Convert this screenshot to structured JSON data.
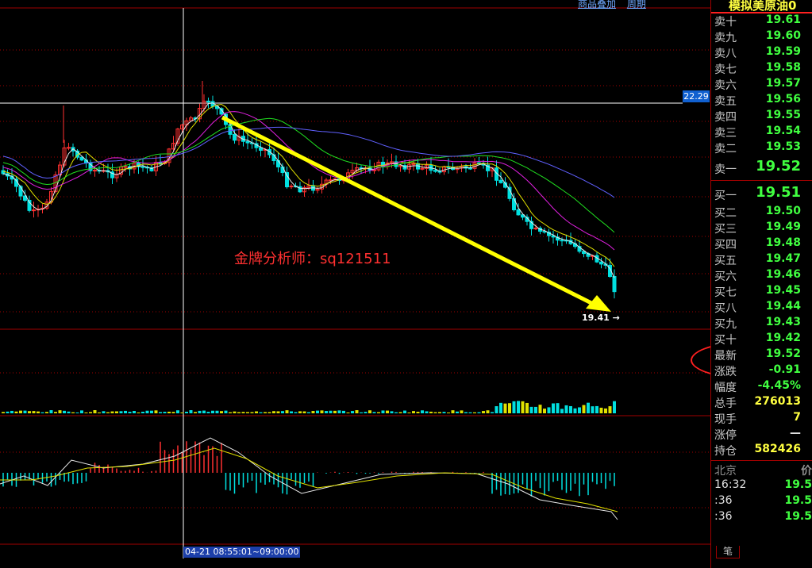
{
  "top_links": [
    "商品叠加",
    "周期"
  ],
  "price_tag": "22.29",
  "last_price_label": "19.41",
  "watermark": "金牌分析师：sq121511",
  "time_label": "04-21 08:55:01~09:00:00",
  "panel": {
    "title": "模拟美原油0",
    "asks": [
      {
        "label": "卖十",
        "value": "19.61"
      },
      {
        "label": "卖九",
        "value": "19.60"
      },
      {
        "label": "卖八",
        "value": "19.59"
      },
      {
        "label": "卖七",
        "value": "19.58"
      },
      {
        "label": "卖六",
        "value": "19.57"
      },
      {
        "label": "卖五",
        "value": "19.56"
      },
      {
        "label": "卖四",
        "value": "19.55"
      },
      {
        "label": "卖三",
        "value": "19.54"
      },
      {
        "label": "卖二",
        "value": "19.53"
      }
    ],
    "ask1": {
      "label": "卖一",
      "value": "19.52"
    },
    "bid1": {
      "label": "买一",
      "value": "19.51"
    },
    "bids": [
      {
        "label": "买二",
        "value": "19.50"
      },
      {
        "label": "买三",
        "value": "19.49"
      },
      {
        "label": "买四",
        "value": "19.48"
      },
      {
        "label": "买五",
        "value": "19.47"
      },
      {
        "label": "买六",
        "value": "19.46"
      },
      {
        "label": "买七",
        "value": "19.45"
      },
      {
        "label": "买八",
        "value": "19.44"
      },
      {
        "label": "买九",
        "value": "19.43"
      },
      {
        "label": "买十",
        "value": "19.42"
      }
    ],
    "stats": [
      {
        "label": "最新",
        "value": "19.52"
      },
      {
        "label": "涨跌",
        "value": "-0.91"
      },
      {
        "label": "幅度",
        "value": "-4.45%"
      },
      {
        "label": "总手",
        "value": "276013"
      },
      {
        "label": "现手",
        "value": "7"
      },
      {
        "label": "涨停",
        "value": "—"
      },
      {
        "label": "持仓",
        "value": "582426"
      }
    ],
    "ticks_header": {
      "label": "北京",
      "value": "价"
    },
    "ticks": [
      {
        "time": "16:32",
        "value": "19.5"
      },
      {
        "time": ":36",
        "value": "19.5"
      },
      {
        "time": ":36",
        "value": "19.5"
      }
    ],
    "tab_brush": "笔"
  },
  "colors": {
    "up_candle": "#ff3030",
    "down_candle": "#00e0e0",
    "ma_white": "#e8e8e8",
    "ma_yellow": "#e0e000",
    "ma_magenta": "#e020e0",
    "ma_green": "#20e020",
    "ma_blue": "#6060ff",
    "arrow": "#ffff00",
    "grid": "#a00000"
  }
}
